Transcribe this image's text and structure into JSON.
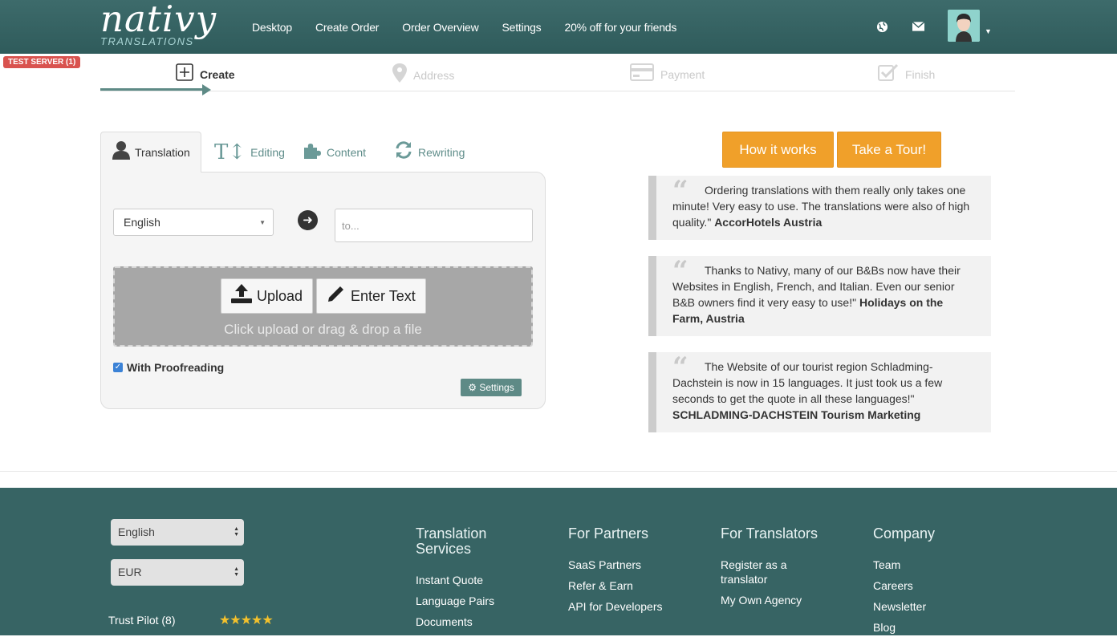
{
  "header": {
    "logo_word": "nativy",
    "logo_sub": "TRANSLATIONS",
    "nav": [
      "Desktop",
      "Create Order",
      "Order Overview",
      "Settings",
      "20% off for your friends"
    ]
  },
  "badge": "TEST SERVER (1)",
  "steps": [
    {
      "label": "Create",
      "icon": "plus-square-icon",
      "active": true
    },
    {
      "label": "Address",
      "icon": "map-pin-icon",
      "active": false
    },
    {
      "label": "Payment",
      "icon": "credit-card-icon",
      "active": false
    },
    {
      "label": "Finish",
      "icon": "check-square-icon",
      "active": false
    }
  ],
  "tabs": [
    {
      "label": "Translation",
      "icon": "user-icon"
    },
    {
      "label": "Editing",
      "icon": "text-height-icon"
    },
    {
      "label": "Content",
      "icon": "puzzle-icon"
    },
    {
      "label": "Rewriting",
      "icon": "refresh-icon"
    }
  ],
  "form": {
    "source_language": "English",
    "target_placeholder": "to...",
    "upload_label": "Upload",
    "enter_text_label": "Enter Text",
    "drop_hint": "Click upload or drag & drop a file",
    "proofreading_label": "With Proofreading",
    "proofreading_checked": true,
    "settings_label": "Settings"
  },
  "actions": {
    "how_it_works": "How it works",
    "tour": "Take a Tour!"
  },
  "testimonials": [
    {
      "text": "Ordering translations with them really only takes one minute! Very easy to use. The translations were also of high quality.\"",
      "author": "AccorHotels Austria"
    },
    {
      "text": "Thanks to Nativy, many of our B&Bs now have their Websites in English, French, and Italian. Even our senior B&B owners find it very easy to use!\"",
      "author": "Holidays on the Farm, Austria"
    },
    {
      "text": "The Website of our tourist region Schladming-Dachstein is now in 15 languages. It just took us a few seconds to get the quote in all these languages!\"",
      "author": "SCHLADMING-DACHSTEIN Tourism Marketing"
    }
  ],
  "footer": {
    "language": "English",
    "currency": "EUR",
    "trust_label": "Trust Pilot (8)",
    "stars": "★★★★★",
    "columns": [
      {
        "title": "Translation Services",
        "links": [
          "Instant Quote",
          "Language Pairs",
          "Documents"
        ]
      },
      {
        "title": "For Partners",
        "links": [
          "SaaS Partners",
          "Refer & Earn",
          "API for Developers"
        ]
      },
      {
        "title": "For Translators",
        "links": [
          "Register as a translator",
          "My Own Agency"
        ]
      },
      {
        "title": "Company",
        "links": [
          "Team",
          "Careers",
          "Newsletter",
          "Blog"
        ]
      }
    ]
  },
  "colors": {
    "header": "#2f5b5b",
    "footer": "#376464",
    "accent": "#5e8a86",
    "orange": "#f0a02a"
  }
}
